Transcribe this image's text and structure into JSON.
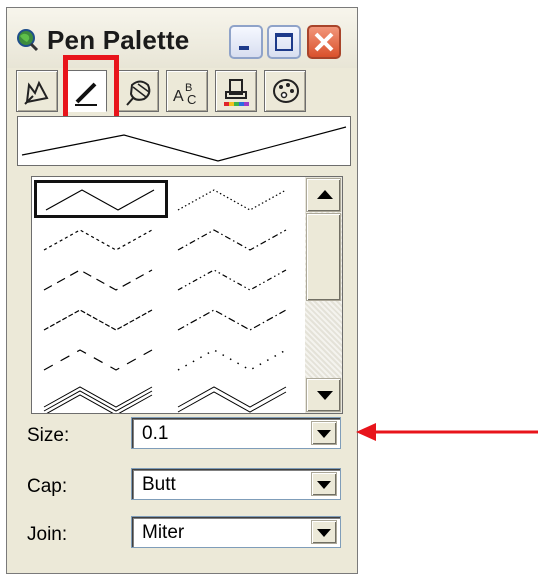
{
  "window": {
    "title": "Pen Palette"
  },
  "tabs": [
    {
      "icon": "pen-select-icon"
    },
    {
      "icon": "pencil-icon",
      "active": true
    },
    {
      "icon": "fill-pattern-icon"
    },
    {
      "icon": "text-style-icon"
    },
    {
      "icon": "paint-bucket-icon"
    },
    {
      "icon": "color-palette-icon"
    }
  ],
  "form": {
    "size_label": "Size:",
    "size_value": "0.1",
    "cap_label": "Cap:",
    "cap_value": "Butt",
    "join_label": "Join:",
    "join_value": "Miter"
  },
  "annotation": {
    "highlight_color": "#e8141b",
    "arrow_color": "#e8141b"
  }
}
